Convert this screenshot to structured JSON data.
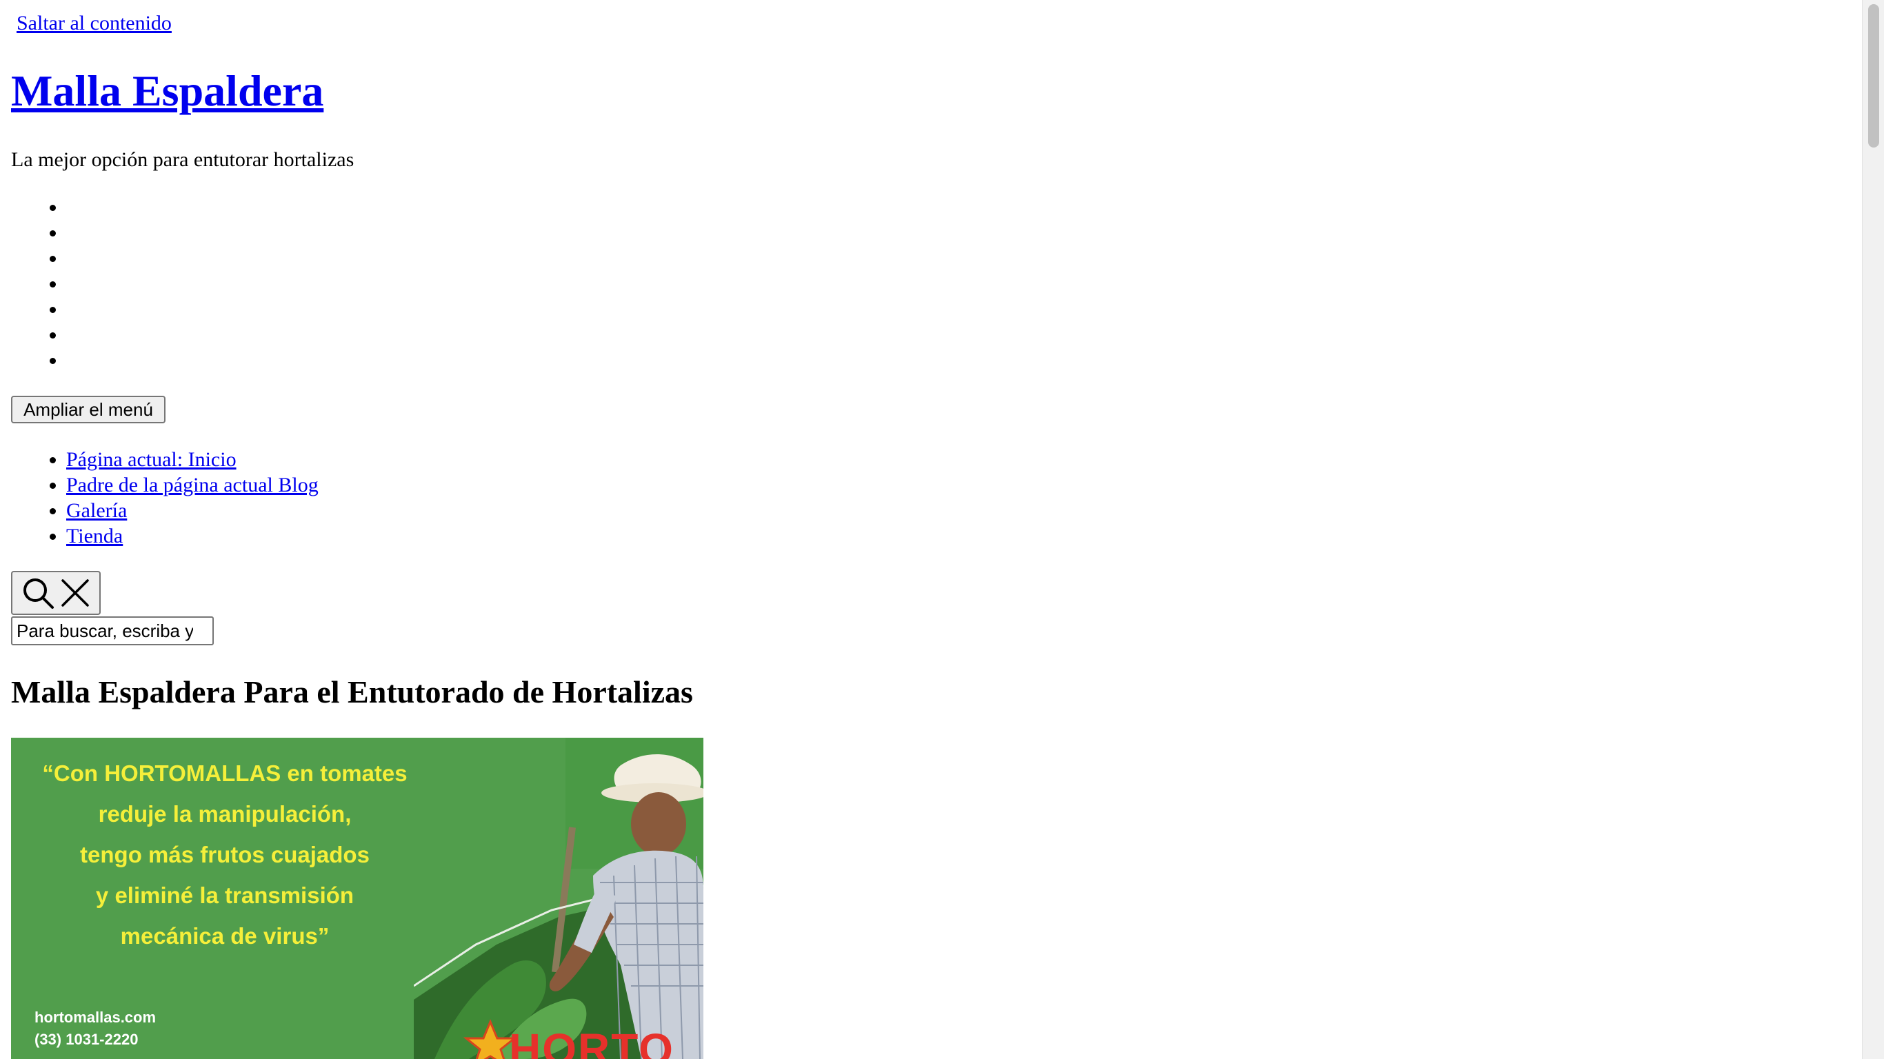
{
  "header": {
    "skip_link": "Saltar al contenido",
    "site_title": "Malla Espaldera",
    "site_description": "La mejor opción para entutorar hortalizas",
    "empty_menu_item_count": 7
  },
  "menu_toggle": {
    "label": "Ampliar el menú"
  },
  "navigation": {
    "items": [
      {
        "label": "Página actual: Inicio"
      },
      {
        "label": "Padre de la página actual Blog"
      },
      {
        "label": "Galería"
      },
      {
        "label": "Tienda"
      }
    ]
  },
  "search": {
    "toggle_icons": [
      "search-icon",
      "close-icon"
    ],
    "placeholder": "Para buscar, escriba y pulse Intro"
  },
  "main": {
    "heading": "Malla Espaldera Para el Entutorado de Hortalizas",
    "hero": {
      "quote_lines": [
        "“Con HORTOMALLAS en tomates",
        "reduje la manipulación,",
        "tengo más frutos cuajados",
        "y eliminé la transmisión",
        "mecánica de virus”"
      ],
      "website": "hortomallas.com",
      "phone": "(33) 1031-2220",
      "logo_text": "HORTO",
      "background_color": "#519e4c",
      "quote_color": "#f5ef3a"
    }
  },
  "colors": {
    "link": "#0000ee",
    "text": "#000000",
    "background": "#ffffff"
  }
}
